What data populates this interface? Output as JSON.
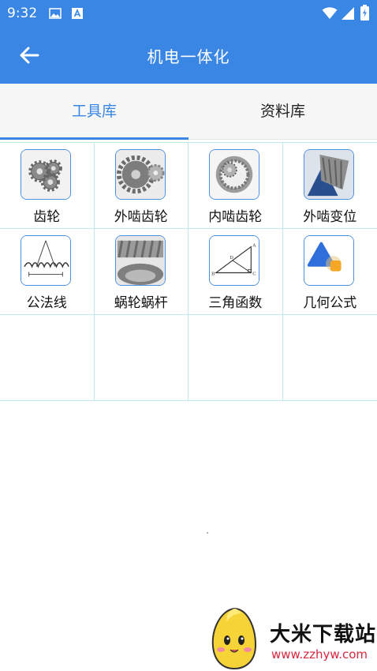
{
  "status_bar": {
    "time": "9:32"
  },
  "app_bar": {
    "title": "机电一体化"
  },
  "tabs": [
    {
      "label": "工具库",
      "active": true
    },
    {
      "label": "资料库",
      "active": false
    }
  ],
  "grid_items": [
    {
      "label": "齿轮",
      "icon": "gears-icon"
    },
    {
      "label": "外啮齿轮",
      "icon": "external-gear-icon"
    },
    {
      "label": "内啮齿轮",
      "icon": "internal-gear-icon"
    },
    {
      "label": "外啮变位",
      "icon": "bevel-gear-icon"
    },
    {
      "label": "公法线",
      "icon": "gear-tooth-diagram-icon"
    },
    {
      "label": "蜗轮蜗杆",
      "icon": "worm-gear-icon"
    },
    {
      "label": "三角函数",
      "icon": "triangle-diagram-icon"
    },
    {
      "label": "几何公式",
      "icon": "geometry-shapes-icon"
    }
  ],
  "watermark": {
    "title": "大米下载站",
    "url": "www.zzhyw.com"
  },
  "colors": {
    "primary": "#3a86e4",
    "grid_line": "#bfe9ea",
    "icon_border": "#4a8fe0"
  }
}
